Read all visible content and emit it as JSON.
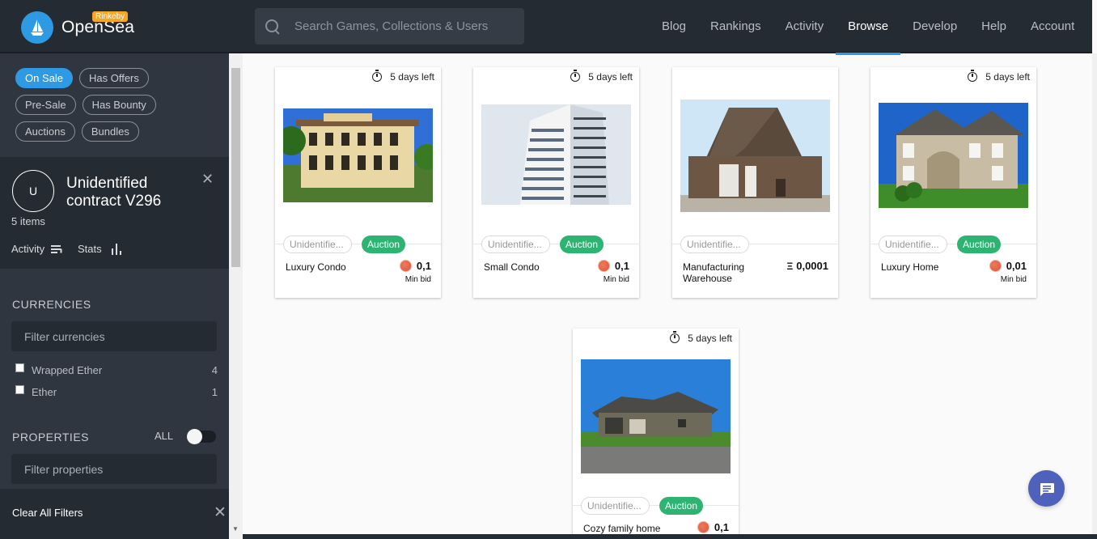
{
  "header": {
    "brand": "OpenSea",
    "network_badge": "Rinkeby",
    "search_placeholder": "Search Games, Collections & Users",
    "nav": [
      {
        "label": "Blog",
        "active": false
      },
      {
        "label": "Rankings",
        "active": false
      },
      {
        "label": "Activity",
        "active": false
      },
      {
        "label": "Browse",
        "active": true
      },
      {
        "label": "Develop",
        "active": false
      },
      {
        "label": "Help",
        "active": false
      },
      {
        "label": "Account",
        "active": false
      }
    ]
  },
  "sidebar": {
    "status_filters": [
      {
        "label": "On Sale",
        "active": true
      },
      {
        "label": "Has Offers",
        "active": false
      },
      {
        "label": "Pre-Sale",
        "active": false
      },
      {
        "label": "Has Bounty",
        "active": false
      },
      {
        "label": "Auctions",
        "active": false
      },
      {
        "label": "Bundles",
        "active": false
      }
    ],
    "collection": {
      "avatar_letter": "U",
      "name": "Unidentified contract V296",
      "items_count": "5 items",
      "activity_label": "Activity",
      "stats_label": "Stats"
    },
    "currencies": {
      "title": "CURRENCIES",
      "filter_placeholder": "Filter currencies",
      "options": [
        {
          "label": "Wrapped Ether",
          "count": "4"
        },
        {
          "label": "Ether",
          "count": "1"
        }
      ]
    },
    "properties": {
      "title": "PROPERTIES",
      "all_label": "ALL",
      "filter_placeholder": "Filter properties"
    },
    "clear_all": "Clear All Filters"
  },
  "cards": [
    {
      "title": "Luxury Condo",
      "timer": "5 days left",
      "collection": "Unidentifie...",
      "badge": "Auction",
      "price": "0,1",
      "currency": "weth",
      "price_note": "Min bid",
      "image": "mansion"
    },
    {
      "title": "Small Condo",
      "timer": "5 days left",
      "collection": "Unidentifie...",
      "badge": "Auction",
      "price": "0,1",
      "currency": "weth",
      "price_note": "Min bid",
      "image": "tower"
    },
    {
      "title": "Manufacturing Warehouse",
      "timer": "",
      "collection": "Unidentifie...",
      "badge": "",
      "price": "0,0001",
      "currency": "eth",
      "price_note": "",
      "image": "barn"
    },
    {
      "title": "Luxury Home",
      "timer": "5 days left",
      "collection": "Unidentifie...",
      "badge": "Auction",
      "price": "0,01",
      "currency": "weth",
      "price_note": "Min bid",
      "image": "house"
    },
    {
      "title": "Cozy family home",
      "timer": "5 days left",
      "collection": "Unidentifie...",
      "badge": "Auction",
      "price": "0,1",
      "currency": "weth",
      "price_note": "",
      "image": "ranch"
    }
  ],
  "colors": {
    "accent": "#2e9ae3",
    "auction_green": "#2db473",
    "sidebar_bg": "#2f3640",
    "header_bg": "#252b33"
  }
}
